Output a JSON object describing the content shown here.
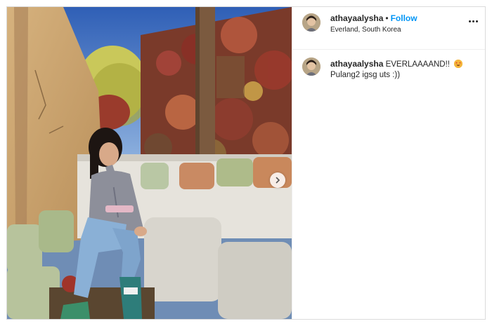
{
  "post": {
    "username": "athayaalysha",
    "separator": "•",
    "follow_label": "Follow",
    "location": "Everland, South Korea",
    "more_icon": "more-horizontal-icon"
  },
  "caption": {
    "username": "athayaalysha",
    "line1": "EVERLAAAAND!!",
    "emoji": "star-struck-face-emoji",
    "line2": "Pulang2 igsg uts :))"
  },
  "media": {
    "description_icon": "photo",
    "next_icon": "chevron-right-icon"
  },
  "colors": {
    "follow": "#0095f6",
    "text": "#262626",
    "border": "#dbdbdb"
  }
}
